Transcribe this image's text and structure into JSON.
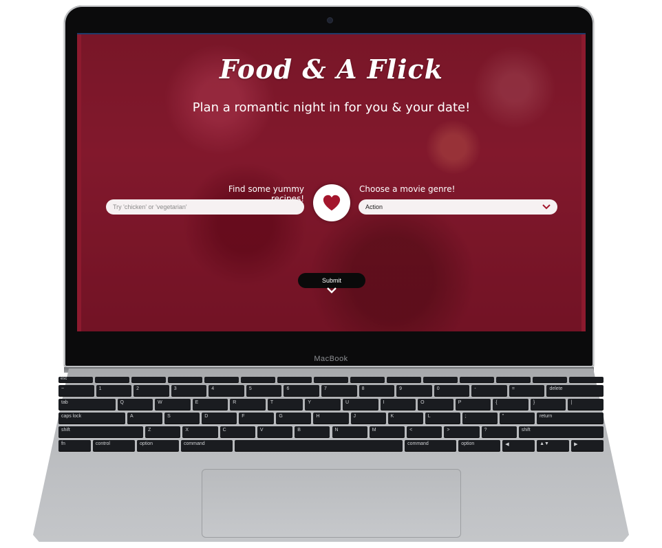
{
  "device": {
    "brand": "MacBook"
  },
  "app": {
    "title": "Food & A Flick",
    "subtitle": "Plan a romantic night in for you & your date!",
    "recipe": {
      "label": "Find some yummy recipes!",
      "placeholder": "Try 'chicken' or 'vegetarian'",
      "value": ""
    },
    "movie": {
      "label": "Choose a movie genre!",
      "selected": "Action"
    },
    "submit_label": "Submit",
    "colors": {
      "accent": "#8c1a2e",
      "heart": "#a3162c",
      "button": "#0a0a0a"
    },
    "icons": {
      "center": "heart-icon",
      "dropdown": "chevron-down-icon",
      "scroll": "chevron-down-icon"
    }
  },
  "keyboard": {
    "fn_row": [
      "esc",
      "",
      "",
      "",
      "",
      "",
      "",
      "",
      "",
      "",
      "",
      "",
      "",
      "",
      ""
    ],
    "row1": [
      "~",
      "1",
      "2",
      "3",
      "4",
      "5",
      "6",
      "7",
      "8",
      "9",
      "0",
      "-",
      "=",
      "delete"
    ],
    "row2": [
      "tab",
      "Q",
      "W",
      "E",
      "R",
      "T",
      "Y",
      "U",
      "I",
      "O",
      "P",
      "{",
      "}",
      "|"
    ],
    "row3": [
      "caps lock",
      "A",
      "S",
      "D",
      "F",
      "G",
      "H",
      "J",
      "K",
      "L",
      ";",
      "\"",
      "return"
    ],
    "row4": [
      "shift",
      "Z",
      "X",
      "C",
      "V",
      "B",
      "N",
      "M",
      "<",
      ">",
      "?",
      "shift"
    ],
    "row5": [
      "fn",
      "control",
      "option",
      "command",
      "",
      "command",
      "option",
      "◀",
      "▲▼",
      "▶"
    ]
  }
}
